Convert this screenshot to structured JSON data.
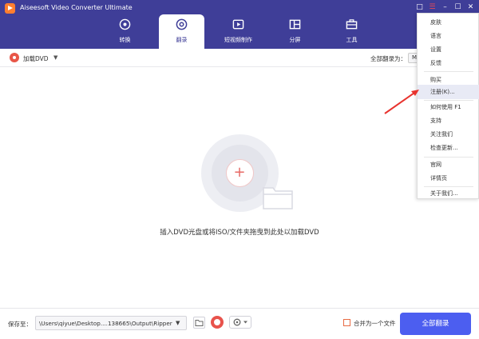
{
  "app": {
    "title": "Aiseesoft Video Converter Ultimate"
  },
  "nav": {
    "tabs": [
      {
        "label": "转换",
        "icon": "convert-icon"
      },
      {
        "label": "翻录",
        "icon": "ripper-icon",
        "active": true
      },
      {
        "label": "短视频制作",
        "icon": "mv-icon"
      },
      {
        "label": "分屏",
        "icon": "collage-icon"
      },
      {
        "label": "工具",
        "icon": "toolbox-icon"
      }
    ]
  },
  "toolbar": {
    "load_dvd": "加载DVD",
    "rip_all_to": "全部翻录为：",
    "rip_all_format": "M"
  },
  "main": {
    "drop_hint": "插入DVD光盘或将ISO/文件夹拖曳到此处以加载DVD"
  },
  "bottom": {
    "save_to": "保存至：",
    "output_path": "\\Users\\qiyue\\Desktop....138665\\Output\\Ripper",
    "merge_label": "合并为一个文件",
    "rip_all_button": "全部翻录"
  },
  "menu": {
    "items": [
      {
        "label": "皮肤"
      },
      {
        "label": "语言"
      },
      {
        "label": "设置"
      },
      {
        "label": "反馈"
      },
      {
        "label": "购买"
      },
      {
        "label": "注册(K)...",
        "highlighted": true
      },
      {
        "label": "如何使用  F1"
      },
      {
        "label": "支持"
      },
      {
        "label": "关注我们"
      },
      {
        "label": "检查更新..."
      },
      {
        "label": "官网"
      },
      {
        "label": "详情页"
      },
      {
        "label": "关于我们..."
      }
    ]
  },
  "colors": {
    "header_bg": "#3f3e98",
    "accent": "#4c5ef0",
    "disc_red": "#e85648",
    "annotation": "#e8332e"
  }
}
